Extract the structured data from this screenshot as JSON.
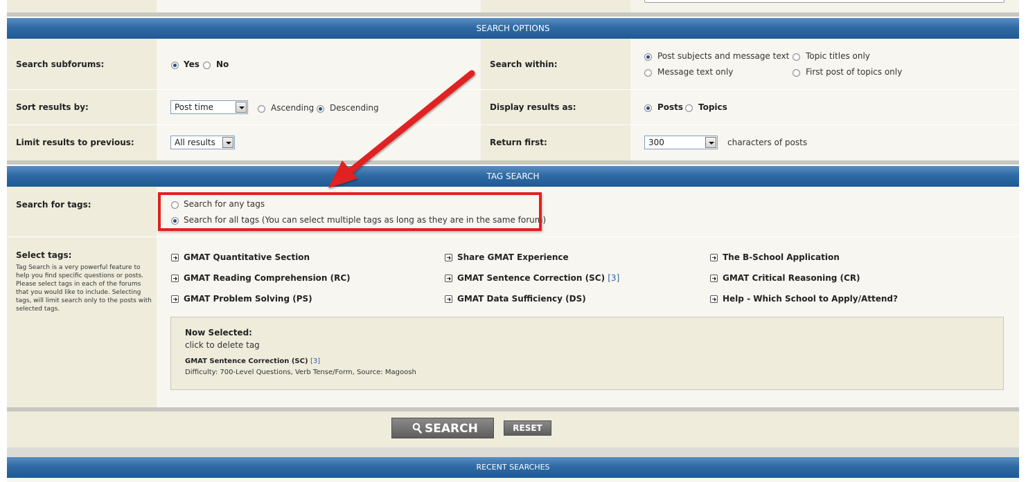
{
  "search_options": {
    "header": "SEARCH OPTIONS",
    "subforums_label": "Search subforums:",
    "subforums_yes": "Yes",
    "subforums_no": "No",
    "search_within_label": "Search within:",
    "within_opt1": "Post subjects and message text",
    "within_opt2": "Topic titles only",
    "within_opt3": "Message text only",
    "within_opt4": "First post of topics only",
    "sort_label": "Sort results by:",
    "sort_value": "Post time",
    "ascending": "Ascending",
    "descending": "Descending",
    "display_label": "Display results as:",
    "display_posts": "Posts",
    "display_topics": "Topics",
    "limit_label": "Limit results to previous:",
    "limit_value": "All results",
    "return_label": "Return first:",
    "return_value": "300",
    "return_suffix": "characters of posts"
  },
  "tag_search": {
    "header": "TAG SEARCH",
    "search_for_label": "Search for tags:",
    "any_tags": "Search for any tags",
    "all_tags": "Search for all tags (You can select multiple tags as long as they are in the same forum)",
    "select_tags_label": "Select tags:",
    "select_tags_help": [
      "Tag Search is a very powerful feature to",
      "help you find specific questions or posts.",
      "Please select tags in each of the forums",
      "that you would like to include. Selecting",
      "tags, will limit search only to the posts with",
      "selected tags."
    ],
    "tags": {
      "t1": "GMAT Quantitative Section",
      "t2": "Share GMAT Experience",
      "t3": "The B-School Application",
      "t4": "GMAT Reading Comprehension (RC)",
      "t5": "GMAT Sentence Correction (SC)",
      "t5_count": "[3]",
      "t6": "GMAT Critical Reasoning (CR)",
      "t7": "GMAT Problem Solving (PS)",
      "t8": "GMAT Data Sufficiency (DS)",
      "t9": "Help - Which School to Apply/Attend?"
    },
    "now_selected_title": "Now Selected:",
    "now_selected_hint": "click to delete tag",
    "selected_tag": "GMAT Sentence Correction (SC)",
    "selected_tag_count": "[3]",
    "selected_tag_details": "Difficulty: 700-Level Questions, Verb Tense/Form, Source: Magoosh"
  },
  "buttons": {
    "search": "SEARCH",
    "reset": "RESET"
  },
  "recent": {
    "header": "RECENT SEARCHES"
  },
  "colors": {
    "header_bar": "#2f6aa4",
    "highlight": "#e02020",
    "arrow": "#e02020"
  }
}
